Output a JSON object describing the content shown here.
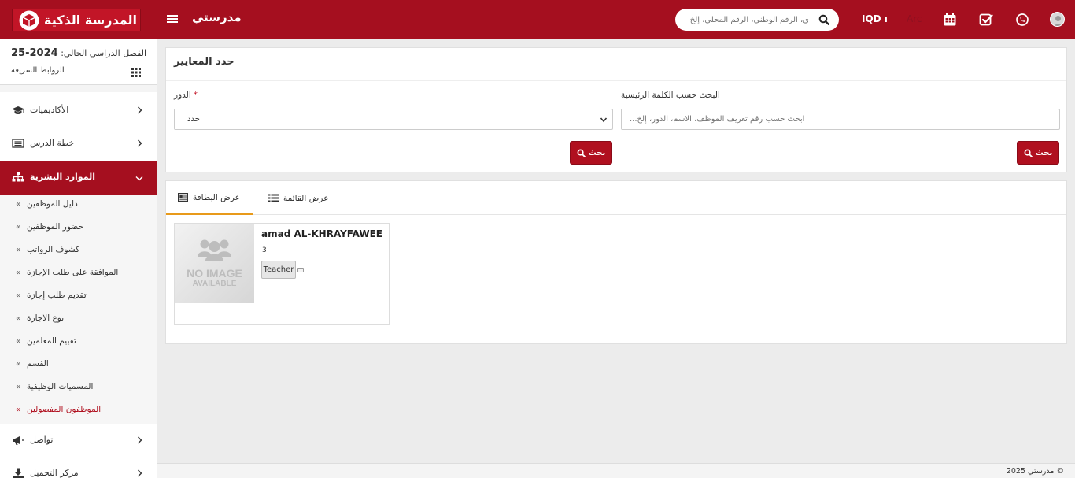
{
  "header": {
    "logo_text": "المدرسة الذكية",
    "app_title": "مدرستي",
    "search_placeholder": "ي، الرقم الوطني، الرقم المحلي، إلخ",
    "currency": "IQD ı",
    "language": "Arc"
  },
  "sidebar": {
    "semester_label": "الفصل الدراسي الحالي:",
    "semester_value": "2024-25",
    "quick_links": "الروابط السريعة",
    "menu": [
      {
        "label": "الأكاديميات",
        "icon": "graduation-cap-icon"
      },
      {
        "label": "خطة الدرس",
        "icon": "list-icon"
      },
      {
        "label": "الموارد البشرية",
        "icon": "sitemap-icon"
      },
      {
        "label": "تواصل",
        "icon": "bullhorn-icon"
      },
      {
        "label": "مركز التحميل",
        "icon": "download-icon"
      }
    ],
    "submenu": [
      "دليل الموظفين",
      "حضور الموظفين",
      "كشوف الرواتب",
      "الموافقة على طلب الإجازة",
      "تقديم طلب إجازة",
      "نوع الاجازة",
      "تقييم المعلمين",
      "القسم",
      "المسميات الوظيفية",
      "الموظفون المفصولين"
    ]
  },
  "filter": {
    "title": "حدد المعايير",
    "role_label": "الدور",
    "role_value": "حدد",
    "keyword_label": "البحث حسب الكلمة الرئيسية",
    "keyword_placeholder": "...ابحث حسب رقم تعريف الموظف، الاسم، الدور، إلخ",
    "search_button": "بحث"
  },
  "results": {
    "tabs": [
      {
        "label": "عرض البطاقة",
        "icon": "id-card-icon"
      },
      {
        "label": "عرض القائمة",
        "icon": "list-icon"
      }
    ],
    "card": {
      "name": "amad AL-KHRAYFAWEE",
      "id": "3",
      "role": "Teacher",
      "no_image_line1": "NO IMAGE",
      "no_image_line2": "AVAILABLE"
    }
  },
  "footer": {
    "copyright": "مدرستي 2025 ©"
  },
  "colors": {
    "brand": "#a50f1f",
    "button": "#b0101f",
    "tab_active": "#e89a1a"
  }
}
